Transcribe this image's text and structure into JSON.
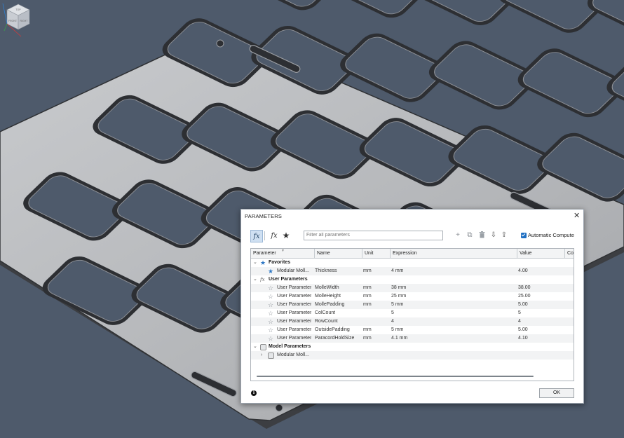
{
  "dialog": {
    "title": "PARAMETERS",
    "close_glyph": "✕",
    "toolbar": {
      "fx_icon": "fx",
      "filter_fx_icon": "fx",
      "favorites_star": "★",
      "filter_placeholder": "Filter all parameters",
      "add_icon": "+",
      "copy_icon": "⧉",
      "delete_icon": "🗑",
      "import_icon": "⇩",
      "export_icon": "⇪",
      "auto_compute_label": "Automatic Compute",
      "auto_compute_checked": true
    },
    "columns": [
      "Parameter",
      "Name",
      "Unit",
      "Expression",
      "Value",
      "Co"
    ],
    "groups": {
      "favorites": {
        "label": "Favorites",
        "rows": [
          {
            "param": "Modular Moll...",
            "name": "Thickness",
            "unit": "mm",
            "expr": "4 mm",
            "value": "4.00"
          }
        ]
      },
      "user": {
        "label": "User Parameters",
        "rows": [
          {
            "param": "User Parameter",
            "name": "MolleWidth",
            "unit": "mm",
            "expr": "38 mm",
            "value": "38.00"
          },
          {
            "param": "User Parameter",
            "name": "MolleHeight",
            "unit": "mm",
            "expr": "25 mm",
            "value": "25.00"
          },
          {
            "param": "User Parameter",
            "name": "MollePadding",
            "unit": "mm",
            "expr": "5 mm",
            "value": "5.00"
          },
          {
            "param": "User Parameter",
            "name": "ColCount",
            "unit": "",
            "expr": "5",
            "value": "5"
          },
          {
            "param": "User Parameter",
            "name": "RowCount",
            "unit": "",
            "expr": "4",
            "value": "4"
          },
          {
            "param": "User Parameter",
            "name": "OutsidePadding",
            "unit": "mm",
            "expr": "5 mm",
            "value": "5.00"
          },
          {
            "param": "User Parameter",
            "name": "ParacordHoldSize",
            "unit": "mm",
            "expr": "4.1 mm",
            "value": "4.10"
          }
        ]
      },
      "model": {
        "label": "Model Parameters",
        "rows": [
          {
            "param": "Modular Moll..."
          }
        ]
      }
    },
    "ok_label": "OK",
    "info_glyph": "i"
  },
  "viewcube": {
    "labels": [
      "TOP",
      "FRONT",
      "RIGHT"
    ]
  },
  "colors": {
    "background": "#4e5a6b",
    "accent": "#2e77c4",
    "plate": "#b7b9bc"
  }
}
